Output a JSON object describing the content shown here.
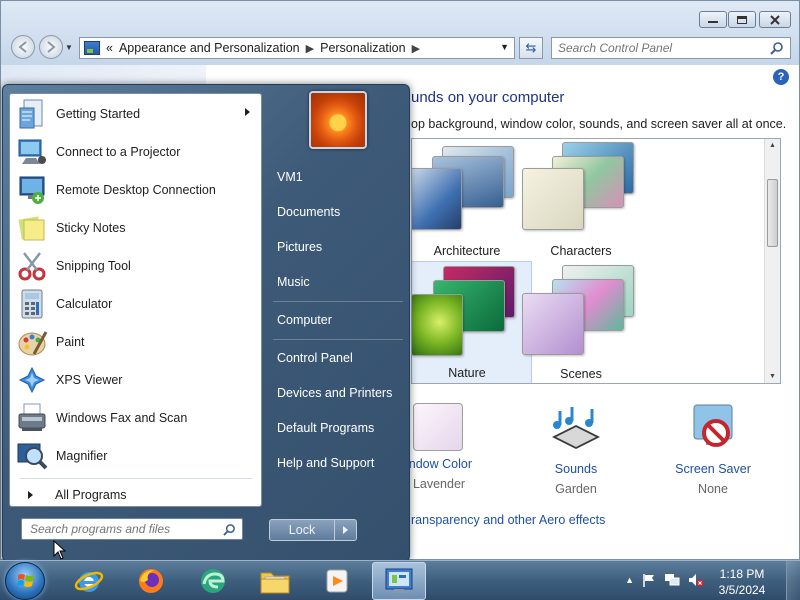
{
  "control_panel": {
    "breadcrumb": [
      "Appearance and Personalization",
      "Personalization"
    ],
    "breadcrumb_prefix": "«",
    "search_placeholder": "Search Control Panel",
    "heading": "unds on your computer",
    "subtitle": "op background, window color, sounds, and screen saver all at once.",
    "themes": [
      {
        "label": "Architecture",
        "selected": false
      },
      {
        "label": "Characters",
        "selected": false
      },
      {
        "label": "Nature",
        "selected": true
      },
      {
        "label": "Scenes",
        "selected": false
      }
    ],
    "settings": {
      "window_color": {
        "label": "indow Color",
        "value": "Lavender"
      },
      "sounds": {
        "label": "Sounds",
        "value": "Garden"
      },
      "screen_saver": {
        "label": "Screen Saver",
        "value": "None"
      }
    },
    "aero_link": "ransparency and other Aero effects"
  },
  "start_menu": {
    "programs": [
      {
        "label": "Getting Started",
        "icon": "getting-started-icon",
        "has_submenu": true
      },
      {
        "label": "Connect to a Projector",
        "icon": "projector-icon"
      },
      {
        "label": "Remote Desktop Connection",
        "icon": "remote-desktop-icon"
      },
      {
        "label": "Sticky Notes",
        "icon": "sticky-notes-icon"
      },
      {
        "label": "Snipping Tool",
        "icon": "snipping-tool-icon"
      },
      {
        "label": "Calculator",
        "icon": "calculator-icon"
      },
      {
        "label": "Paint",
        "icon": "paint-icon"
      },
      {
        "label": "XPS Viewer",
        "icon": "xps-viewer-icon"
      },
      {
        "label": "Windows Fax and Scan",
        "icon": "fax-scan-icon"
      },
      {
        "label": "Magnifier",
        "icon": "magnifier-icon"
      }
    ],
    "all_programs": "All Programs",
    "search_placeholder": "Search programs and files",
    "right_links": [
      "VM1",
      "Documents",
      "Pictures",
      "Music",
      "Computer",
      "Control Panel",
      "Devices and Printers",
      "Default Programs",
      "Help and Support"
    ],
    "lock_label": "Lock"
  },
  "taskbar": {
    "pinned": [
      "internet-explorer-icon",
      "firefox-icon",
      "edge-icon",
      "file-explorer-icon",
      "media-player-icon",
      "control-panel-icon"
    ],
    "time": "1:18 PM",
    "date": "3/5/2024"
  }
}
